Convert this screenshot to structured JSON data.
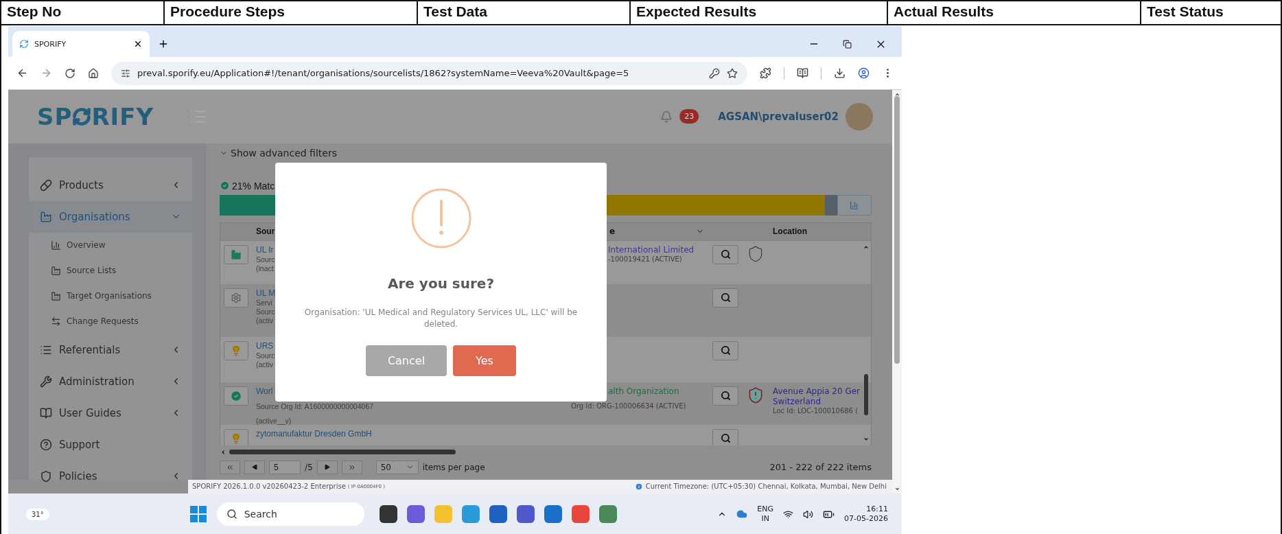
{
  "doc_table": {
    "columns": [
      "Step No",
      "Procedure Steps",
      "Test Data",
      "Expected Results",
      "Actual Results",
      "Test Status"
    ]
  },
  "browser": {
    "tab_title": "SPORIFY",
    "url": "preval.sporify.eu/Application#!/tenant/organisations/sourcelists/1862?systemName=Veeva%20Vault&page=5"
  },
  "app": {
    "logo_left": "SP",
    "logo_right": "RIFY",
    "notifications": "23",
    "user": "AGSAN\\prevaluser02"
  },
  "sidebar": {
    "items": [
      {
        "label": "Products",
        "selected": false,
        "expanded": false
      },
      {
        "label": "Organisations",
        "selected": true,
        "expanded": true,
        "children": [
          {
            "label": "Overview"
          },
          {
            "label": "Source Lists"
          },
          {
            "label": "Target Organisations"
          },
          {
            "label": "Change Requests"
          }
        ]
      },
      {
        "label": "Referentials",
        "selected": false,
        "expanded": false
      },
      {
        "label": "Administration",
        "selected": false,
        "expanded": false
      },
      {
        "label": "User Guides",
        "selected": false,
        "expanded": false
      },
      {
        "label": "Support",
        "selected": false
      },
      {
        "label": "Policies",
        "selected": false,
        "expanded": false
      }
    ]
  },
  "filters_toggle": "Show advanced filters",
  "match": {
    "label": "21% Matc",
    "segments": [
      {
        "color": "#15765c",
        "level": 0.21
      },
      {
        "color": "#917600",
        "level": 0.98
      }
    ]
  },
  "table": {
    "source_header": "Sour",
    "name_header": "e",
    "location_header": "Location",
    "rows": [
      {
        "kind": "factory",
        "source": [
          "UL Ir",
          "Sourc",
          "(inact"
        ],
        "name": {
          "text": "International Limited",
          "color": "#3b36a8"
        },
        "name_id": "-100019421 (ACTIVE)",
        "shield": {
          "kind": "outline"
        }
      },
      {
        "kind": "gear",
        "source": [
          "UL M",
          "Servi",
          "Sourc",
          "(activ"
        ]
      },
      {
        "kind": "bulb",
        "source": [
          "URS",
          "Sourc",
          "(activ"
        ]
      },
      {
        "kind": "check",
        "source": [
          "Worl",
          "Source Org Id: A1600000000004067",
          "(active__v)"
        ],
        "name": {
          "text": "alth Organization",
          "color": "#1c6e3e"
        },
        "name_id": "Org Id: ORG-100006634 (ACTIVE)",
        "shield": {
          "kind": "alert"
        },
        "location": [
          "Avenue Appia 20 Ger",
          "Switzerland"
        ],
        "location_id": "Loc Id: LOC-100010686 ("
      },
      {
        "kind": "bulb",
        "source": [
          "zytomanufaktur Dresden GmbH"
        ]
      }
    ]
  },
  "pagination": {
    "page": "5",
    "pages": "/5",
    "per_page": "50",
    "per_page_label": "items per page",
    "summary": "201 - 222 of 222 items"
  },
  "footer": {
    "version": "SPORIFY 2026.1.0.0 v20260423-2 Enterprise",
    "build": "( IP-0A0004F0 )",
    "timezone": "Current Timezone: (UTC+05:30) Chennai, Kolkata, Mumbai, New Delhi"
  },
  "modal": {
    "title": "Are you sure?",
    "message": "Organisation: 'UL Medical and Regulatory Services UL, LLC' will be deleted.",
    "buttons": [
      {
        "label": "Cancel",
        "kind": "cancel"
      },
      {
        "label": "Yes",
        "kind": "confirm"
      }
    ]
  },
  "taskbar": {
    "weather": "31°",
    "search": "Search",
    "lang": "ENG",
    "region": "IN",
    "time": "16:11",
    "date": "07-05-2026"
  }
}
